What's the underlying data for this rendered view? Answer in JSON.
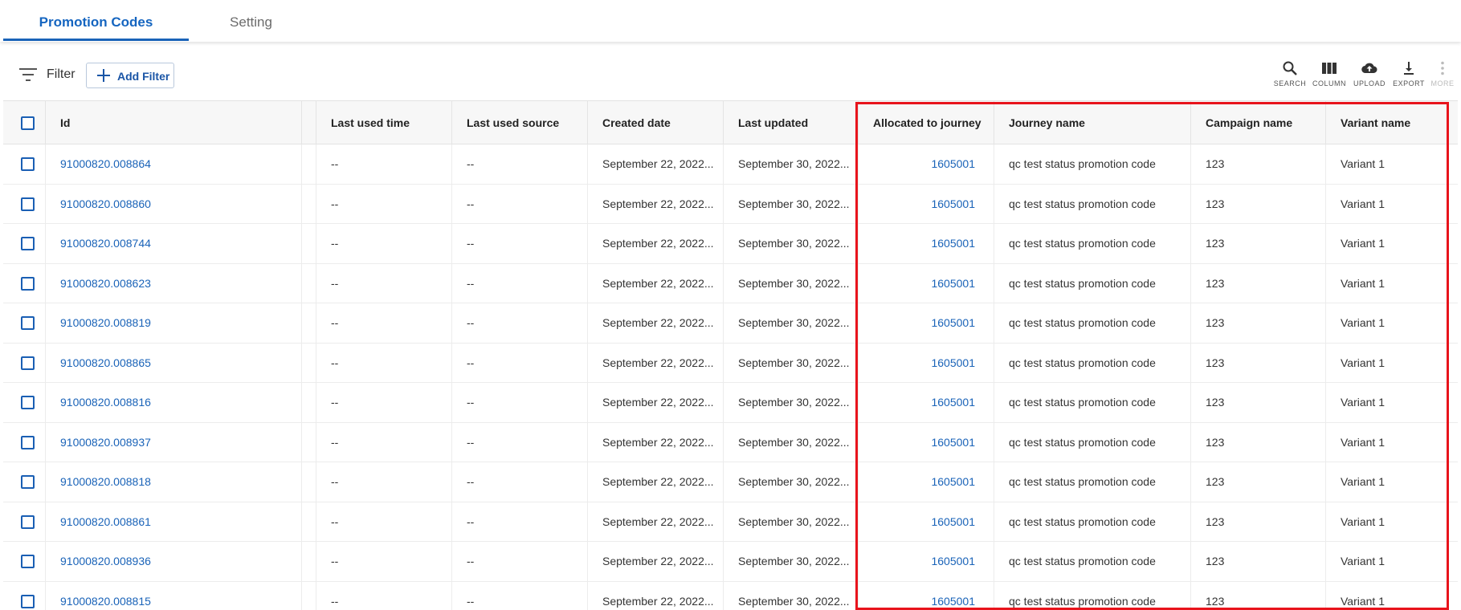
{
  "tabs": [
    {
      "label": "Promotion Codes",
      "active": true
    },
    {
      "label": "Setting",
      "active": false
    }
  ],
  "toolbar": {
    "filter_label": "Filter",
    "add_filter_label": "Add Filter",
    "actions": [
      {
        "label": "SEARCH",
        "icon": "search-icon",
        "enabled": true
      },
      {
        "label": "COLUMN",
        "icon": "column-icon",
        "enabled": true
      },
      {
        "label": "UPLOAD",
        "icon": "upload-icon",
        "enabled": true
      },
      {
        "label": "EXPORT",
        "icon": "export-icon",
        "enabled": true
      },
      {
        "label": "MORE",
        "icon": "more-vert-icon",
        "enabled": false
      }
    ]
  },
  "table": {
    "columns": [
      "Id",
      "",
      "Last used time",
      "Last used source",
      "Created date",
      "Last updated",
      "Allocated to journey",
      "Journey name",
      "Campaign name",
      "Variant name"
    ],
    "rows": [
      {
        "id": "91000820.008864",
        "last_used_time": "--",
        "last_used_source": "--",
        "created": "September 22, 2022...",
        "updated": "September 30, 2022...",
        "journey": "1605001",
        "journey_name": "qc test status promotion code",
        "campaign": "123",
        "variant": "Variant 1"
      },
      {
        "id": "91000820.008860",
        "last_used_time": "--",
        "last_used_source": "--",
        "created": "September 22, 2022...",
        "updated": "September 30, 2022...",
        "journey": "1605001",
        "journey_name": "qc test status promotion code",
        "campaign": "123",
        "variant": "Variant 1"
      },
      {
        "id": "91000820.008744",
        "last_used_time": "--",
        "last_used_source": "--",
        "created": "September 22, 2022...",
        "updated": "September 30, 2022...",
        "journey": "1605001",
        "journey_name": "qc test status promotion code",
        "campaign": "123",
        "variant": "Variant 1"
      },
      {
        "id": "91000820.008623",
        "last_used_time": "--",
        "last_used_source": "--",
        "created": "September 22, 2022...",
        "updated": "September 30, 2022...",
        "journey": "1605001",
        "journey_name": "qc test status promotion code",
        "campaign": "123",
        "variant": "Variant 1"
      },
      {
        "id": "91000820.008819",
        "last_used_time": "--",
        "last_used_source": "--",
        "created": "September 22, 2022...",
        "updated": "September 30, 2022...",
        "journey": "1605001",
        "journey_name": "qc test status promotion code",
        "campaign": "123",
        "variant": "Variant 1"
      },
      {
        "id": "91000820.008865",
        "last_used_time": "--",
        "last_used_source": "--",
        "created": "September 22, 2022...",
        "updated": "September 30, 2022...",
        "journey": "1605001",
        "journey_name": "qc test status promotion code",
        "campaign": "123",
        "variant": "Variant 1"
      },
      {
        "id": "91000820.008816",
        "last_used_time": "--",
        "last_used_source": "--",
        "created": "September 22, 2022...",
        "updated": "September 30, 2022...",
        "journey": "1605001",
        "journey_name": "qc test status promotion code",
        "campaign": "123",
        "variant": "Variant 1"
      },
      {
        "id": "91000820.008937",
        "last_used_time": "--",
        "last_used_source": "--",
        "created": "September 22, 2022...",
        "updated": "September 30, 2022...",
        "journey": "1605001",
        "journey_name": "qc test status promotion code",
        "campaign": "123",
        "variant": "Variant 1"
      },
      {
        "id": "91000820.008818",
        "last_used_time": "--",
        "last_used_source": "--",
        "created": "September 22, 2022...",
        "updated": "September 30, 2022...",
        "journey": "1605001",
        "journey_name": "qc test status promotion code",
        "campaign": "123",
        "variant": "Variant 1"
      },
      {
        "id": "91000820.008861",
        "last_used_time": "--",
        "last_used_source": "--",
        "created": "September 22, 2022...",
        "updated": "September 30, 2022...",
        "journey": "1605001",
        "journey_name": "qc test status promotion code",
        "campaign": "123",
        "variant": "Variant 1"
      },
      {
        "id": "91000820.008936",
        "last_used_time": "--",
        "last_used_source": "--",
        "created": "September 22, 2022...",
        "updated": "September 30, 2022...",
        "journey": "1605001",
        "journey_name": "qc test status promotion code",
        "campaign": "123",
        "variant": "Variant 1"
      },
      {
        "id": "91000820.008815",
        "last_used_time": "--",
        "last_used_source": "--",
        "created": "September 22, 2022...",
        "updated": "September 30, 2022...",
        "journey": "1605001",
        "journey_name": "qc test status promotion code",
        "campaign": "123",
        "variant": "Variant 1"
      }
    ]
  },
  "colors": {
    "accent": "#1a63b8",
    "highlight_border": "#e8141c",
    "header_bg": "#f7f7f7"
  }
}
